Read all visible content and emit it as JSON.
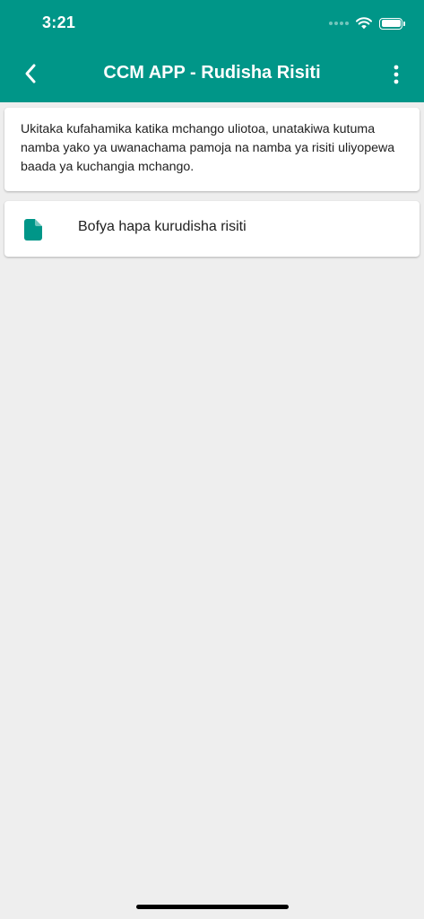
{
  "status_bar": {
    "time": "3:21"
  },
  "app_bar": {
    "title": "CCM APP - Rudisha Risiti"
  },
  "info_card": {
    "text": "Ukitaka kufahamika katika mchango uliotoa, unatakiwa kutuma namba yako ya uwanachama pamoja na namba ya risiti uliyopewa baada ya kuchangia mchango."
  },
  "action_card": {
    "label": "Bofya hapa kurudisha risiti",
    "icon": "file-icon"
  },
  "colors": {
    "primary": "#009688",
    "background": "#eeeeee",
    "card": "#ffffff",
    "text": "#212121"
  }
}
